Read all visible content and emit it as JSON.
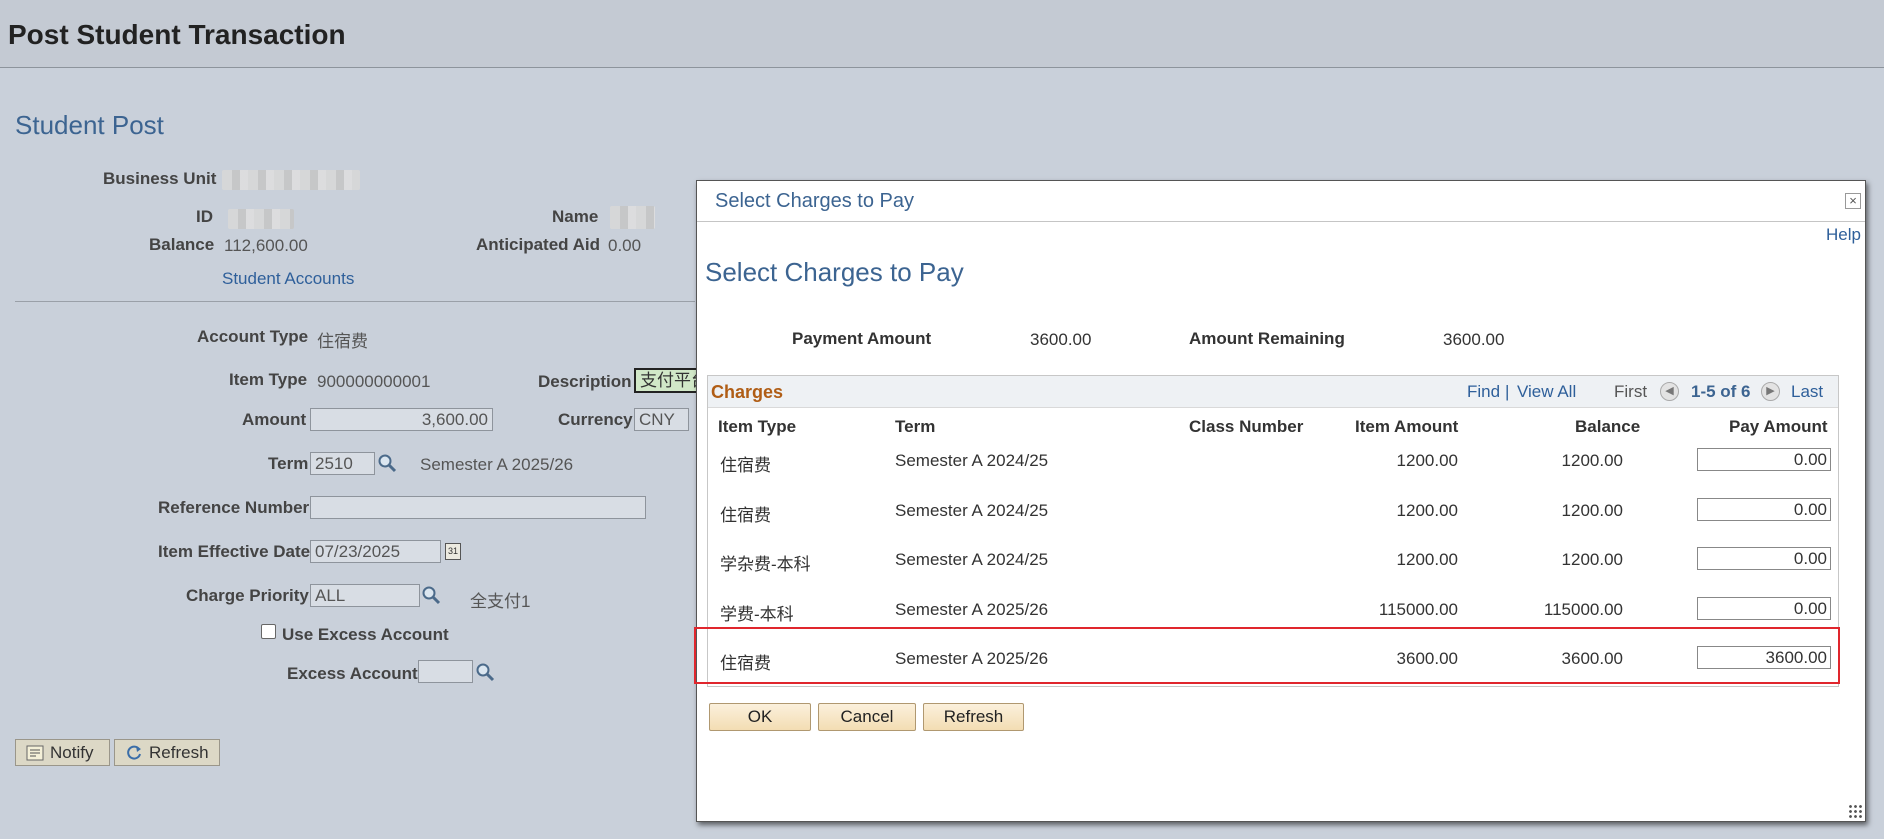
{
  "page": {
    "title": "Post Student Transaction",
    "section_title": "Student Post"
  },
  "student": {
    "business_unit_label": "Business Unit",
    "id_label": "ID",
    "name_label": "Name",
    "balance_label": "Balance",
    "balance_value": "112,600.00",
    "anticipated_aid_label": "Anticipated Aid",
    "anticipated_aid_value": "0.00",
    "student_accounts_link": "Student Accounts"
  },
  "form": {
    "account_type_label": "Account Type",
    "account_type_value": "住宿费",
    "item_type_label": "Item Type",
    "item_type_value": "900000000001",
    "description_label": "Description",
    "description_value": "支付平台",
    "amount_label": "Amount",
    "amount_value": "3,600.00",
    "currency_label": "Currency",
    "currency_value": "CNY",
    "term_label": "Term",
    "term_value": "2510",
    "term_description": "Semester A 2025/26",
    "reference_number_label": "Reference Number",
    "reference_number_value": "",
    "item_effective_date_label": "Item Effective Date",
    "item_effective_date_value": "07/23/2025",
    "charge_priority_label": "Charge Priority",
    "charge_priority_value": "ALL",
    "charge_priority_description": "全支付1",
    "use_excess_account_label": "Use Excess Account",
    "excess_account_label": "Excess Account",
    "excess_account_value": ""
  },
  "toolbar": {
    "notify_label": "Notify",
    "refresh_label": "Refresh"
  },
  "modal": {
    "title_bar": "Select Charges to Pay",
    "help_label": "Help",
    "heading": "Select Charges to Pay",
    "payment_amount_label": "Payment Amount",
    "payment_amount_value": "3600.00",
    "amount_remaining_label": "Amount Remaining",
    "amount_remaining_value": "3600.00",
    "grid": {
      "title": "Charges",
      "find_label": "Find",
      "separator": "|",
      "view_all_label": "View All",
      "first_label": "First",
      "range_label": "1-5 of 6",
      "last_label": "Last",
      "columns": [
        "Item Type",
        "Term",
        "Class Number",
        "Item Amount",
        "Balance",
        "Pay Amount"
      ],
      "rows": [
        {
          "item_type": "住宿费",
          "term": "Semester A 2024/25",
          "class_number": "",
          "item_amount": "1200.00",
          "balance": "1200.00",
          "pay_amount": "0.00"
        },
        {
          "item_type": "住宿费",
          "term": "Semester A 2024/25",
          "class_number": "",
          "item_amount": "1200.00",
          "balance": "1200.00",
          "pay_amount": "0.00"
        },
        {
          "item_type": "学杂费-本科",
          "term": "Semester A 2024/25",
          "class_number": "",
          "item_amount": "1200.00",
          "balance": "1200.00",
          "pay_amount": "0.00"
        },
        {
          "item_type": "学费-本科",
          "term": "Semester A 2025/26",
          "class_number": "",
          "item_amount": "115000.00",
          "balance": "115000.00",
          "pay_amount": "0.00"
        },
        {
          "item_type": "住宿费",
          "term": "Semester A 2025/26",
          "class_number": "",
          "item_amount": "3600.00",
          "balance": "3600.00",
          "pay_amount": "3600.00"
        }
      ]
    },
    "ok_label": "OK",
    "cancel_label": "Cancel",
    "refresh_label": "Refresh"
  },
  "colors": {
    "page_bg": "#c9d0da",
    "title_blue": "#3c6491",
    "grid_title": "#b05d15",
    "highlight": "#e0262d"
  }
}
